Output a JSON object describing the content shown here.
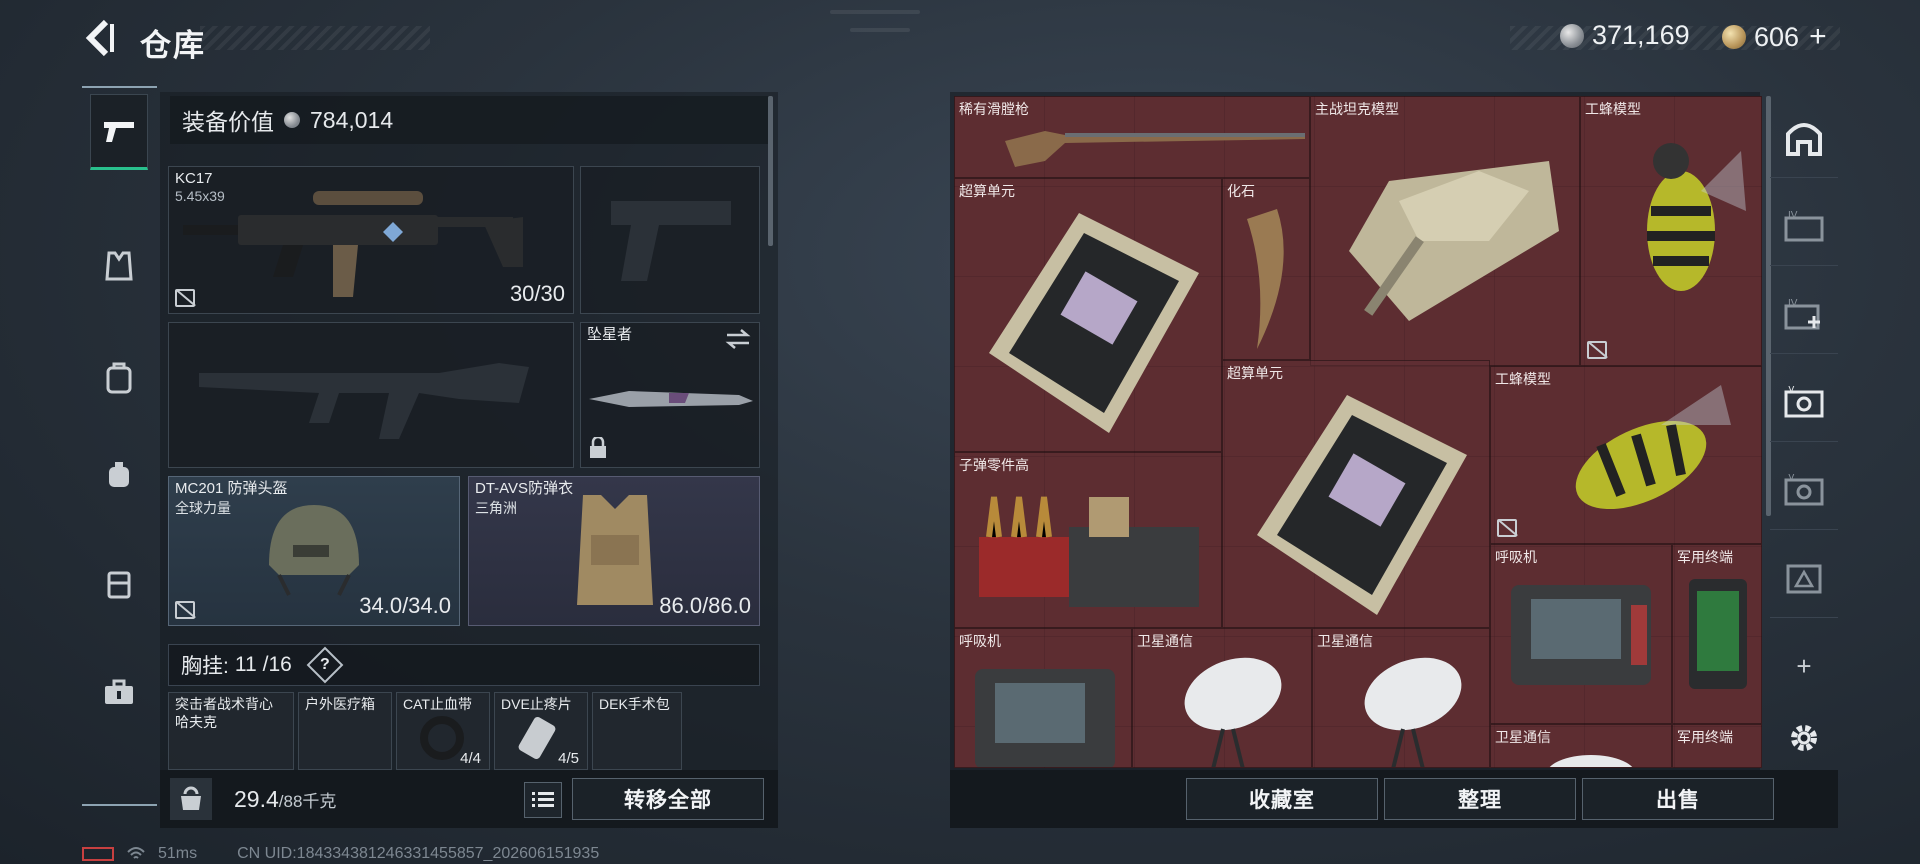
{
  "header": {
    "title": "仓库"
  },
  "currency": {
    "silver": "371,169",
    "gold": "606",
    "plus": "+"
  },
  "equipment": {
    "value_label": "装备价值",
    "value": "784,014",
    "primary": {
      "name": "KC17",
      "caliber": "5.45x39",
      "ammo": "30/30"
    },
    "melee": {
      "name": "坠星者"
    },
    "helmet": {
      "name": "MC201 防弹头盔",
      "brand": "全球力量",
      "durability": "34.0/34.0"
    },
    "armor": {
      "name": "DT-AVS防弹衣",
      "brand": "三角洲",
      "durability": "86.0/86.0"
    },
    "chest": {
      "label": "胸挂:",
      "used": "11",
      "total": "/16",
      "help": "?"
    },
    "chest_items": [
      {
        "name": "突击者战术背心",
        "sub": "哈夫克"
      },
      {
        "name": "户外医疗箱",
        "sub": ""
      },
      {
        "name": "CAT止血带",
        "sub": "",
        "count": "4/4"
      },
      {
        "name": "DVE止疼片",
        "sub": "",
        "count": "4/5"
      },
      {
        "name": "DEK手术包",
        "sub": ""
      }
    ],
    "weight": {
      "value": "29.4",
      "max": "/88千克"
    },
    "transfer_all": "转移全部"
  },
  "stash": {
    "items": [
      {
        "name": "稀有滑膛枪"
      },
      {
        "name": "主战坦克模型"
      },
      {
        "name": "工蜂模型"
      },
      {
        "name": "超算单元"
      },
      {
        "name": "化石"
      },
      {
        "name": "超算单元"
      },
      {
        "name": "工蜂模型"
      },
      {
        "name": "子弹零件高"
      },
      {
        "name": "呼吸机"
      },
      {
        "name": "军用终端"
      },
      {
        "name": "呼吸机"
      },
      {
        "name": "卫星通信"
      },
      {
        "name": "卫星通信"
      },
      {
        "name": "卫星通信"
      },
      {
        "name": "军用终端"
      }
    ],
    "buttons": {
      "collection": "收藏室",
      "organize": "整理",
      "sell": "出售"
    }
  },
  "right_rail": {
    "add": "+"
  },
  "status": {
    "ping": "51ms",
    "uid": "CN UID:18433438124633145585​7_202606151935"
  },
  "colors": {
    "accent": "#29c08d",
    "stash_bg": "#5a2a2e",
    "panel": "#14191e"
  }
}
